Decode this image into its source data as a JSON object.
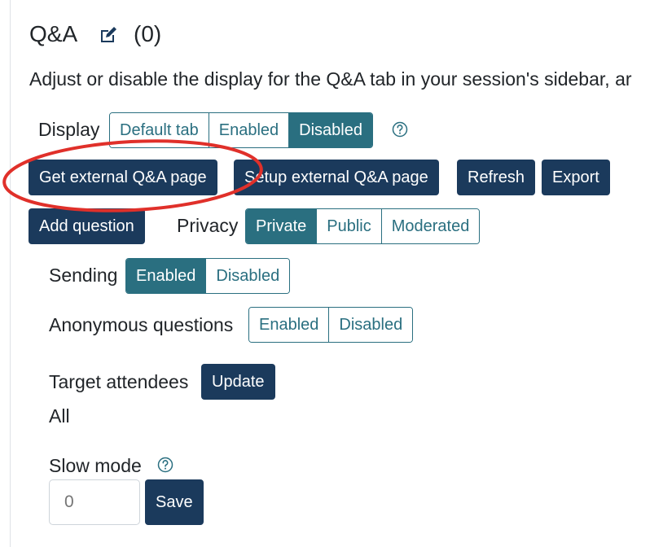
{
  "section": {
    "title": "Q&A",
    "count": "(0)",
    "description": "Adjust or disable the display for the Q&A tab in your session's sidebar, ar"
  },
  "display": {
    "label": "Display",
    "options": [
      "Default tab",
      "Enabled",
      "Disabled"
    ],
    "selected": "Disabled"
  },
  "actions": {
    "get_external": "Get external Q&A page",
    "setup_external": "Setup external Q&A page",
    "refresh": "Refresh",
    "export": "Export",
    "add_question": "Add question"
  },
  "privacy": {
    "label": "Privacy",
    "options": [
      "Private",
      "Public",
      "Moderated"
    ],
    "selected": "Private"
  },
  "sending": {
    "label": "Sending",
    "options": [
      "Enabled",
      "Disabled"
    ],
    "selected": "Enabled"
  },
  "anonymous": {
    "label": "Anonymous questions",
    "options": [
      "Enabled",
      "Disabled"
    ]
  },
  "target": {
    "label": "Target attendees",
    "update": "Update",
    "value": "All"
  },
  "slow_mode": {
    "label": "Slow mode",
    "placeholder": "0",
    "save": "Save"
  },
  "colors": {
    "primary_navy": "#1b3a5c",
    "teal": "#2a6f80",
    "annotation_red": "#e0302a"
  },
  "icons": {
    "edit": "edit-icon",
    "help": "help-icon"
  }
}
